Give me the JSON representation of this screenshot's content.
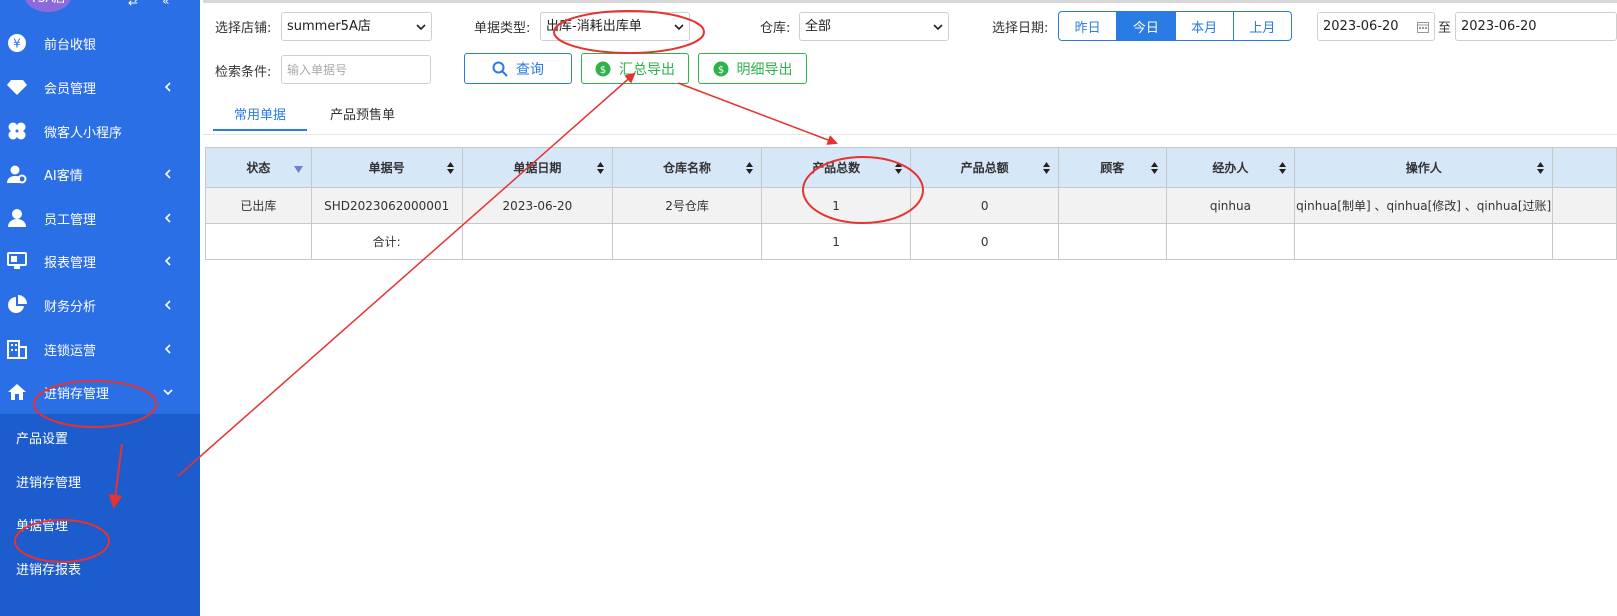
{
  "sidebar": {
    "brand_text": "TSA店",
    "items": [
      {
        "label": "前台收银",
        "icon": "yen-coin-icon"
      },
      {
        "label": "会员管理",
        "icon": "diamond-icon"
      },
      {
        "label": "微客人小程序",
        "icon": "clover-icon"
      },
      {
        "label": "AI客情",
        "icon": "user-gear-icon"
      },
      {
        "label": "员工管理",
        "icon": "user-icon"
      },
      {
        "label": "报表管理",
        "icon": "monitor-icon"
      },
      {
        "label": "财务分析",
        "icon": "pie-icon"
      },
      {
        "label": "连锁运营",
        "icon": "building-icon"
      },
      {
        "label": "进销存管理",
        "icon": "home-icon"
      }
    ],
    "sub_items": [
      {
        "label": "产品设置"
      },
      {
        "label": "进销存管理"
      },
      {
        "label": "单据管理"
      },
      {
        "label": "进销存报表"
      }
    ]
  },
  "filters": {
    "store_label": "选择店铺:",
    "store_value": "summer5A店",
    "doc_type_label": "单据类型:",
    "doc_type_value": "出库-消耗出库单",
    "warehouse_label": "仓库:",
    "warehouse_value": "全部",
    "date_label": "选择日期:",
    "date_buttons": [
      "昨日",
      "今日",
      "本月",
      "上月"
    ],
    "date_active": "今日",
    "date_from": "2023-06-20",
    "date_sep": "至",
    "date_to": "2023-06-20",
    "search_label": "检索条件:",
    "search_placeholder": "输入单据号"
  },
  "actions": {
    "query": "查询",
    "summary_export": "汇总导出",
    "detail_export": "明细导出"
  },
  "tabs": [
    {
      "label": "常用单据",
      "active": true
    },
    {
      "label": "产品预售单",
      "active": false
    }
  ],
  "table": {
    "headers": [
      "状态",
      "单据号",
      "单据日期",
      "仓库名称",
      "产品总数",
      "产品总额",
      "顾客",
      "经办人",
      "操作人"
    ],
    "rows": [
      [
        "已出库",
        "SHD2023062000001",
        "2023-06-20",
        "2号仓库",
        "1",
        "0",
        "",
        "qinhua",
        "qinhua[制单] 、qinhua[修改] 、qinhua[过账]"
      ]
    ],
    "total_row": [
      "",
      "合计:",
      "",
      "",
      "1",
      "0",
      "",
      "",
      ""
    ]
  },
  "colors": {
    "sidebar": "#2a6fe6",
    "submenu": "#1d5ccc",
    "accent": "#2a7be4",
    "export_green": "#2fb24a",
    "annotation_red": "#e8322f",
    "header_bg": "#d6e7f8"
  }
}
